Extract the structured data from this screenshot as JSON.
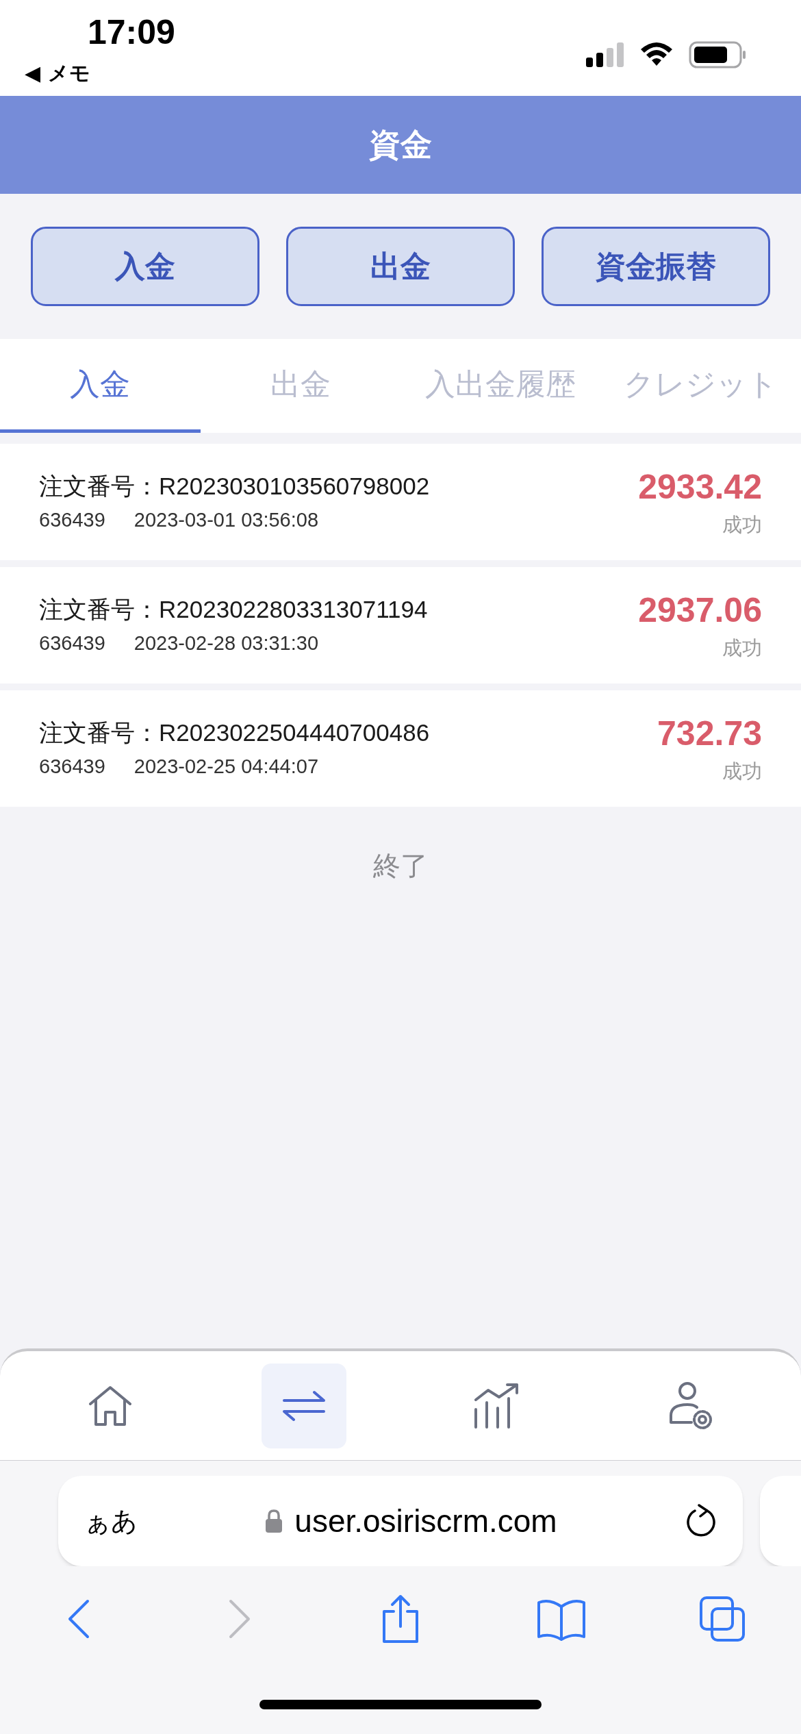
{
  "status_bar": {
    "time": "17:09",
    "back_app": "◀ メモ"
  },
  "header": {
    "title": "資金"
  },
  "action_buttons": [
    "入金",
    "出金",
    "資金振替"
  ],
  "tabs": [
    {
      "label": "入金",
      "selected": true
    },
    {
      "label": "出金",
      "selected": false
    },
    {
      "label": "入出金履歴",
      "selected": false
    },
    {
      "label": "クレジット",
      "selected": false
    }
  ],
  "records": [
    {
      "order": "注文番号：R2023030103560798002",
      "account": "636439",
      "time": "2023-03-01 03:56:08",
      "amount": "2933.42",
      "status": "成功"
    },
    {
      "order": "注文番号：R2023022803313071194",
      "account": "636439",
      "time": "2023-02-28 03:31:30",
      "amount": "2937.06",
      "status": "成功"
    },
    {
      "order": "注文番号：R2023022504440700486",
      "account": "636439",
      "time": "2023-02-25 04:44:07",
      "amount": "732.73",
      "status": "成功"
    }
  ],
  "list_end": "終了",
  "bottom_nav": [
    {
      "kind": "home",
      "selected": false
    },
    {
      "kind": "transfer",
      "selected": true
    },
    {
      "kind": "chart",
      "selected": false
    },
    {
      "kind": "account",
      "selected": false
    }
  ],
  "browser": {
    "text_size": "ぁあ",
    "url": "user.osiriscrm.com",
    "toolbar": [
      {
        "kind": "back",
        "disabled": false
      },
      {
        "kind": "forward",
        "disabled": true
      },
      {
        "kind": "share",
        "disabled": false
      },
      {
        "kind": "bookmarks",
        "disabled": false
      },
      {
        "kind": "tabs",
        "disabled": false
      }
    ]
  }
}
